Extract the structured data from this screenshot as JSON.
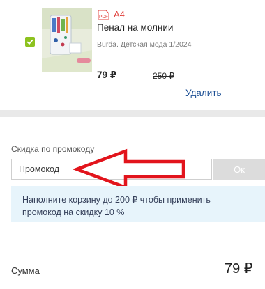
{
  "cart_item": {
    "checked": true,
    "format_badge": "PDF",
    "format": "A4",
    "title": "Пенал на молнии",
    "source": "Burda. Детская мода 1/2024",
    "price": "79 ₽",
    "old_price": "250 ₽",
    "delete_label": "Удалить"
  },
  "promo": {
    "label": "Скидка по промокоду",
    "placeholder": "Промокод",
    "apply_label": "Ок",
    "notice_lines": [
      "Наполните корзину до 200 ₽ чтобы применить",
      "промокод на скидку 10 %"
    ]
  },
  "summary": {
    "label": "Сумма",
    "total": "79 ₽"
  },
  "colors": {
    "accent_green": "#8dc21f",
    "link_blue": "#1c4f94",
    "format_red": "#e0403b",
    "arrow_red": "#e2141c",
    "notice_bg": "#e7f4fb"
  }
}
